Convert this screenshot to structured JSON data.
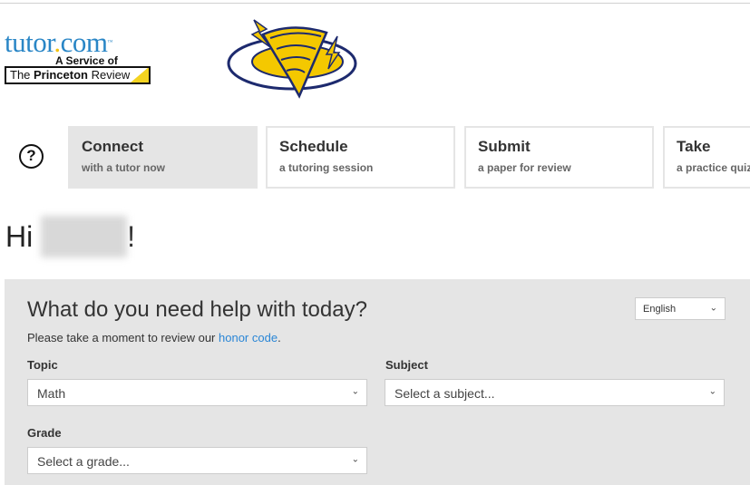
{
  "header": {
    "logo": {
      "brand": "tutor",
      "dot": ".",
      "brand_tld": "com",
      "tm": "™",
      "service_of": "A Service of",
      "partner_light": "The ",
      "partner_bold": "Princeton",
      "partner_end": " Review"
    },
    "mascot_icon": "tornado-mascot-logo"
  },
  "nav": {
    "help_icon": "question-circle-icon",
    "help_glyph": "?",
    "tabs": [
      {
        "title": "Connect",
        "subtitle": "with a tutor now",
        "active": true
      },
      {
        "title": "Schedule",
        "subtitle": "a tutoring session",
        "active": false
      },
      {
        "title": "Submit",
        "subtitle": "a paper for review",
        "active": false
      },
      {
        "title": "Take",
        "subtitle": "a practice quiz",
        "active": false
      }
    ]
  },
  "greeting": {
    "prefix": "Hi ",
    "suffix": "!"
  },
  "form": {
    "heading": "What do you need help with today?",
    "language": "English",
    "note_prefix": "Please take a moment to review our ",
    "note_link": "honor code",
    "note_suffix": ".",
    "topic_label": "Topic",
    "topic_value": "Math",
    "subject_label": "Subject",
    "subject_value": "Select a subject...",
    "grade_label": "Grade",
    "grade_value": "Select a grade...",
    "chevron": "⌄"
  },
  "colors": {
    "brand_blue": "#2a86c6",
    "accent_yellow": "#f4c20d",
    "panel_gray": "#e5e5e5",
    "link_blue": "#2a86d6"
  }
}
